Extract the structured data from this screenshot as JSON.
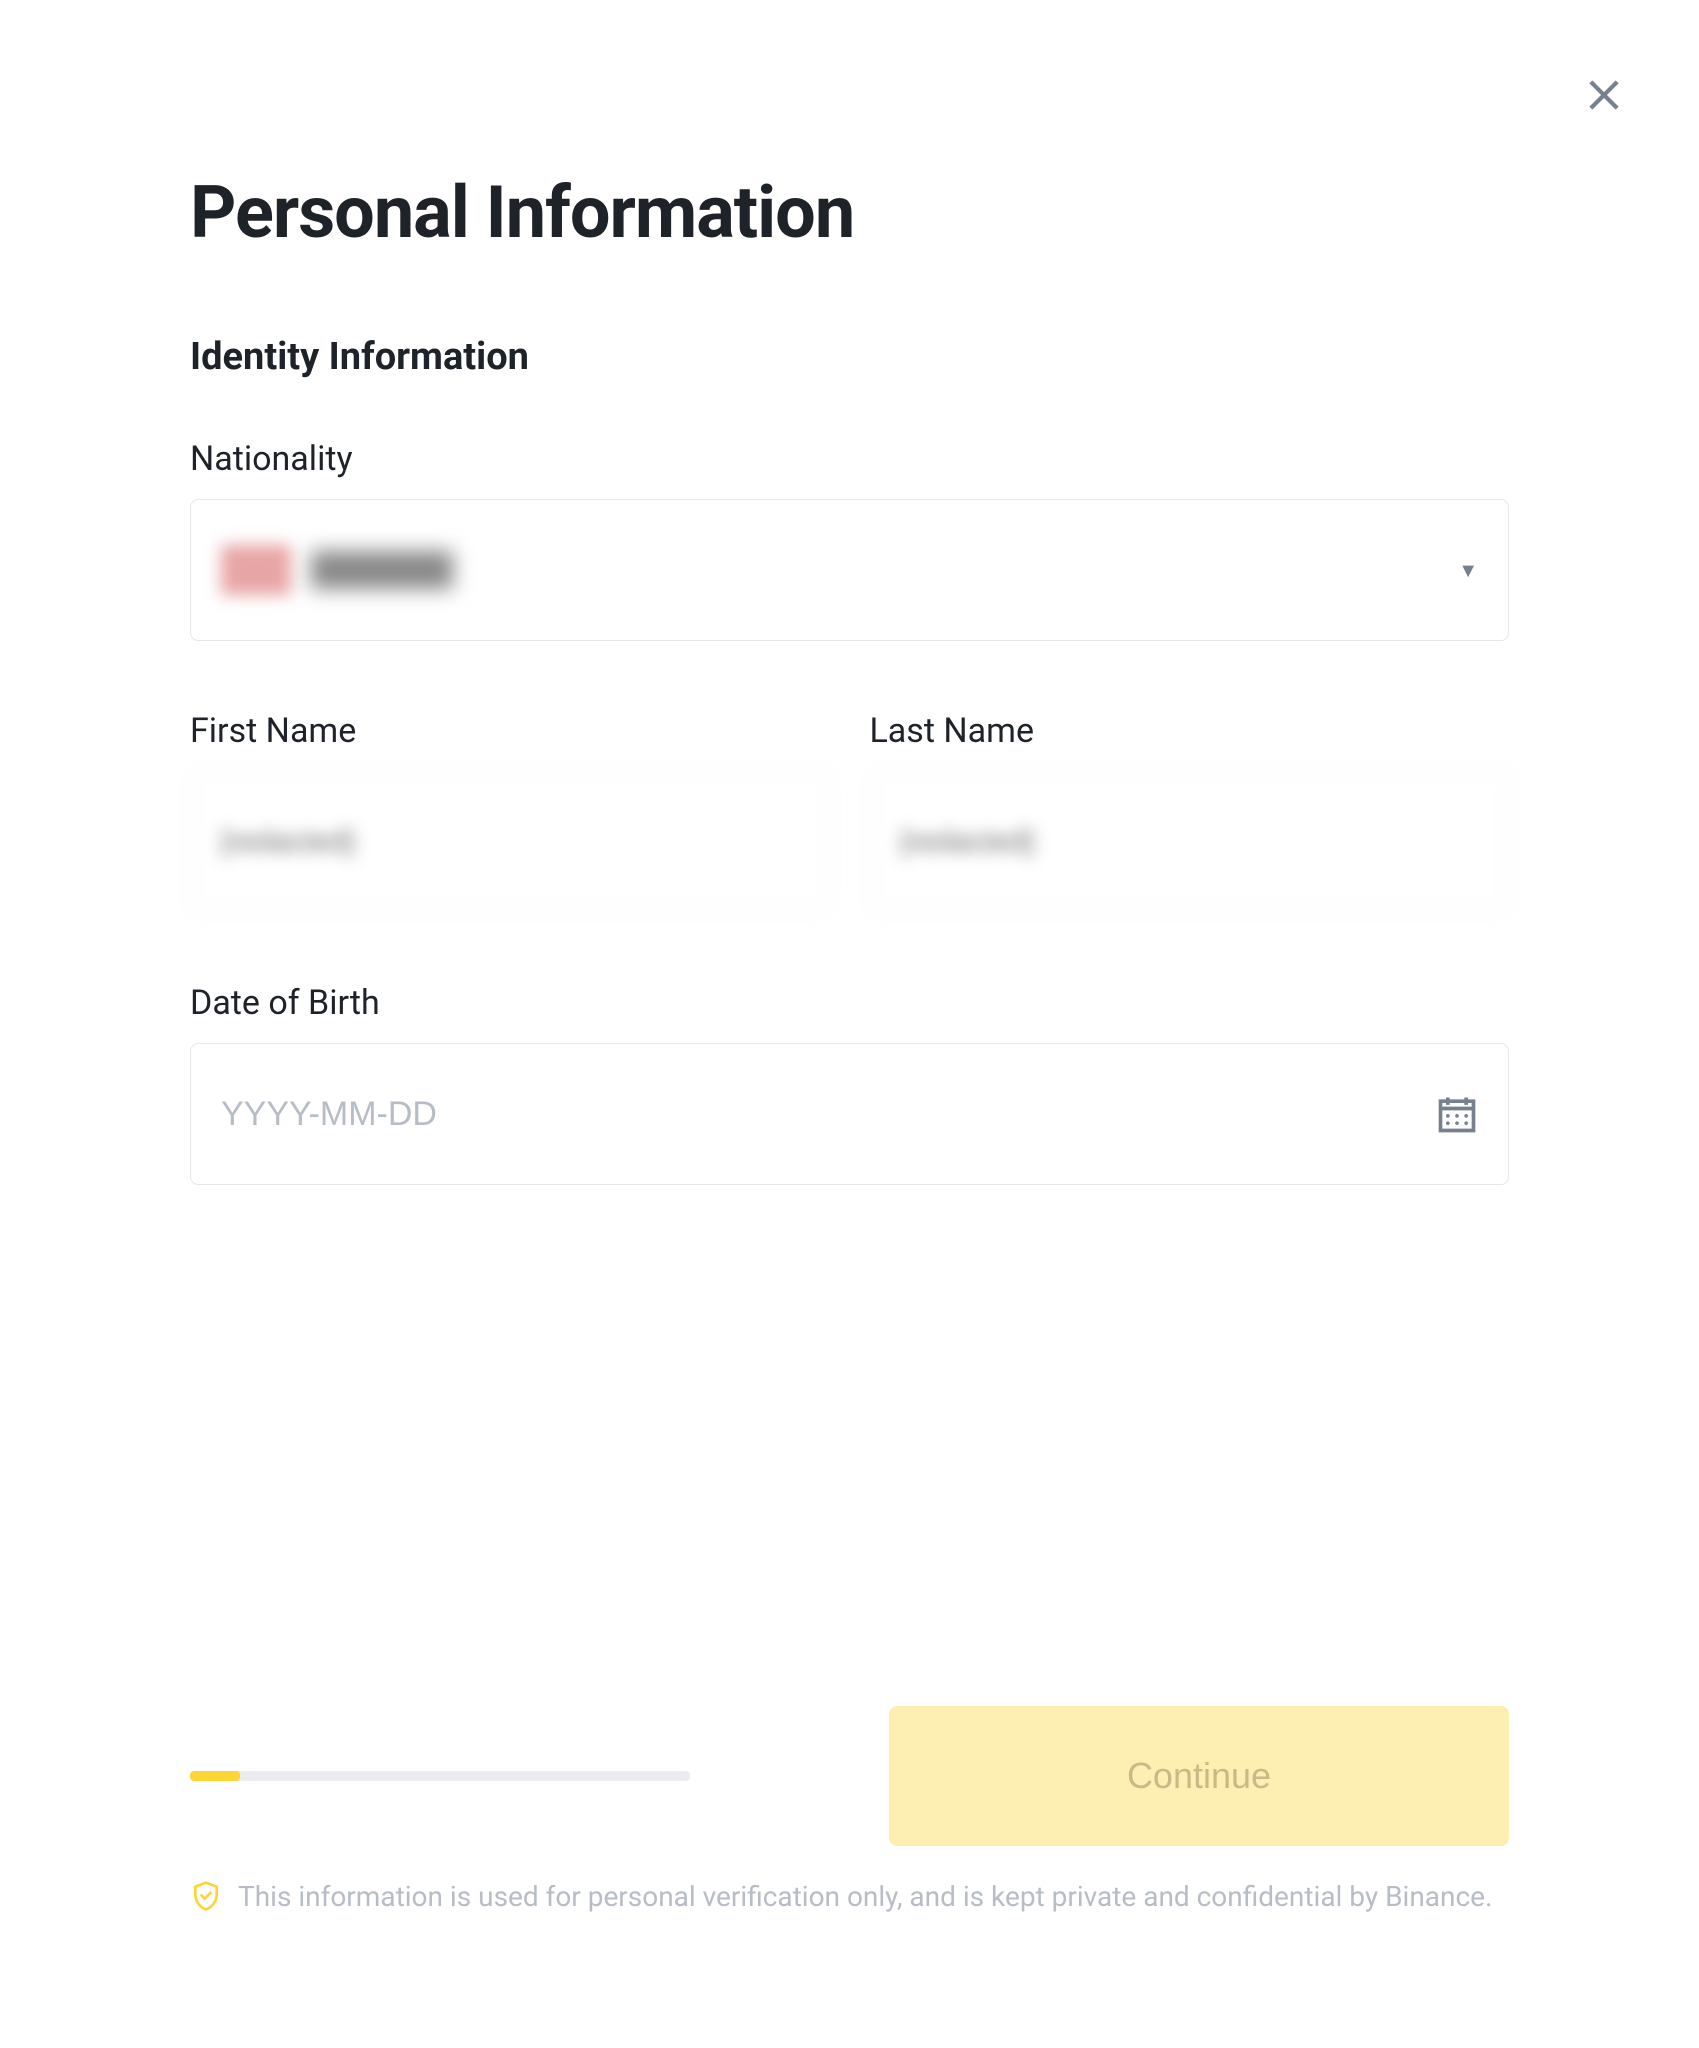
{
  "title": "Personal Information",
  "section": "Identity Information",
  "fields": {
    "nationality": {
      "label": "Nationality",
      "value": "[redacted]"
    },
    "firstName": {
      "label": "First Name",
      "value": "[redacted]"
    },
    "lastName": {
      "label": "Last Name",
      "value": "[redacted]"
    },
    "dateOfBirth": {
      "label": "Date of Birth",
      "placeholder": "YYYY-MM-DD",
      "value": ""
    }
  },
  "progress": {
    "percent": 10
  },
  "actions": {
    "continueLabel": "Continue"
  },
  "disclaimer": "This information is used for personal verification only, and is kept private and confidential by Binance."
}
